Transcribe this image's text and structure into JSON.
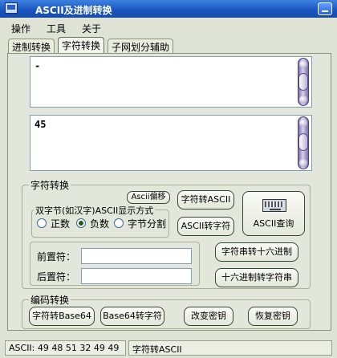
{
  "window": {
    "title": "ASCII及进制转换"
  },
  "menu": {
    "items": [
      "操作",
      "工具",
      "关于"
    ]
  },
  "tabs": [
    "进制转换",
    "字符转换",
    "子网划分辅助"
  ],
  "active_tab": "字符转换",
  "input_area": {
    "value": "-"
  },
  "output_area": {
    "value": "45"
  },
  "char_group": {
    "title": "字符转换",
    "ascii_shift_button": "Ascii偏移",
    "display_mode": {
      "title": "双字节(如汉字)ASCII显示方式",
      "options": [
        "正数",
        "负数",
        "字节分割"
      ],
      "selected": "负数"
    },
    "char_to_ascii_button": "字符转ASCII",
    "ascii_to_char_button": "ASCII转字符",
    "ascii_query_button": "ASCII查询",
    "prefix_label": "前置符：",
    "prefix_value": "",
    "suffix_label": "后置符：",
    "suffix_value": "",
    "str_to_hex_button": "字符串转十六进制",
    "hex_to_str_button": "十六进制转字符串"
  },
  "encode_group": {
    "title": "编码转换",
    "to_base64_button": "字符转Base64",
    "from_base64_button": "Base64转字符",
    "change_key_button": "改变密钥",
    "restore_key_button": "恢复密钥"
  },
  "status": {
    "left": "ASCII: 49 48 51 32 49 49",
    "right": "字符转ASCII"
  }
}
